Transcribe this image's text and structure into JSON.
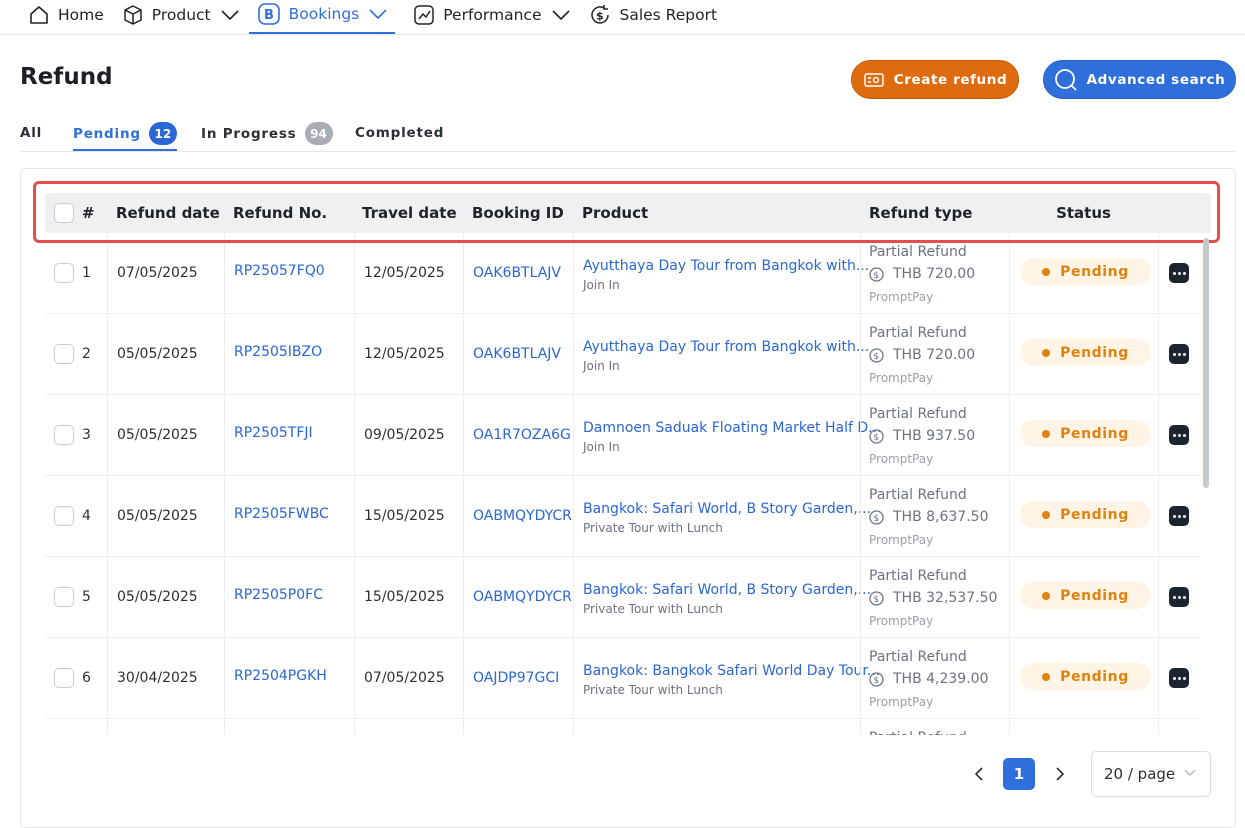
{
  "nav": {
    "home": "Home",
    "product": "Product",
    "bookings": "Bookings",
    "performance": "Performance",
    "sales_report": "Sales Report"
  },
  "page": {
    "title": "Refund",
    "create_refund": "Create refund",
    "advanced_search": "Advanced search"
  },
  "tabs": {
    "all": "All",
    "pending": "Pending",
    "pending_count": "12",
    "in_progress": "In Progress",
    "in_progress_count": "94",
    "completed": "Completed"
  },
  "table": {
    "headers": {
      "num": "#",
      "refund_date": "Refund date",
      "refund_no": "Refund No.",
      "travel_date": "Travel date",
      "booking_id": "Booking ID",
      "product": "Product",
      "refund_type": "Refund type",
      "status": "Status"
    },
    "rows": [
      {
        "num": "1",
        "refund_date": "07/05/2025",
        "refund_no": "RP25057FQ0",
        "travel_date": "12/05/2025",
        "booking_id": "OAK6BTLAJV",
        "product": "Ayutthaya Day Tour from Bangkok with...",
        "product_sub": "Join In",
        "refund_type": "Partial Refund",
        "amount": "THB 720.00",
        "method": "PromptPay",
        "status": "Pending"
      },
      {
        "num": "2",
        "refund_date": "05/05/2025",
        "refund_no": "RP2505IBZO",
        "travel_date": "12/05/2025",
        "booking_id": "OAK6BTLAJV",
        "product": "Ayutthaya Day Tour from Bangkok with...",
        "product_sub": "Join In",
        "refund_type": "Partial Refund",
        "amount": "THB 720.00",
        "method": "PromptPay",
        "status": "Pending"
      },
      {
        "num": "3",
        "refund_date": "05/05/2025",
        "refund_no": "RP2505TFJI",
        "travel_date": "09/05/2025",
        "booking_id": "OA1R7OZA6G",
        "product": "Damnoen Saduak Floating Market Half D...",
        "product_sub": "Join In",
        "refund_type": "Partial Refund",
        "amount": "THB 937.50",
        "method": "PromptPay",
        "status": "Pending"
      },
      {
        "num": "4",
        "refund_date": "05/05/2025",
        "refund_no": "RP2505FWBC",
        "travel_date": "15/05/2025",
        "booking_id": "OABMQYDYCR",
        "product": "Bangkok: Safari World, B Story Garden,...",
        "product_sub": "Private Tour with Lunch",
        "refund_type": "Partial Refund",
        "amount": "THB 8,637.50",
        "method": "PromptPay",
        "status": "Pending"
      },
      {
        "num": "5",
        "refund_date": "05/05/2025",
        "refund_no": "RP2505P0FC",
        "travel_date": "15/05/2025",
        "booking_id": "OABMQYDYCR",
        "product": "Bangkok: Safari World, B Story Garden,...",
        "product_sub": "Private Tour with Lunch",
        "refund_type": "Partial Refund",
        "amount": "THB 32,537.50",
        "method": "PromptPay",
        "status": "Pending"
      },
      {
        "num": "6",
        "refund_date": "30/04/2025",
        "refund_no": "RP2504PGKH",
        "travel_date": "07/05/2025",
        "booking_id": "OAJDP97GCI",
        "product": "Bangkok: Bangkok Safari World Day Tour...",
        "product_sub": "Private Tour with Lunch",
        "refund_type": "Partial Refund",
        "amount": "THB 4,239.00",
        "method": "PromptPay",
        "status": "Pending"
      },
      {
        "num": "",
        "refund_date": "",
        "refund_no": "",
        "travel_date": "",
        "booking_id": "",
        "product": "",
        "product_sub": "",
        "refund_type": "Partial Refund",
        "amount": "",
        "method": "",
        "status": ""
      }
    ]
  },
  "pagination": {
    "current_page": "1",
    "page_size": "20 / page"
  },
  "colors": {
    "accent_blue": "#2f6fdb",
    "orange": "#df6b0f",
    "pending_text": "#e0820e",
    "highlight_outline": "#e2504b"
  }
}
